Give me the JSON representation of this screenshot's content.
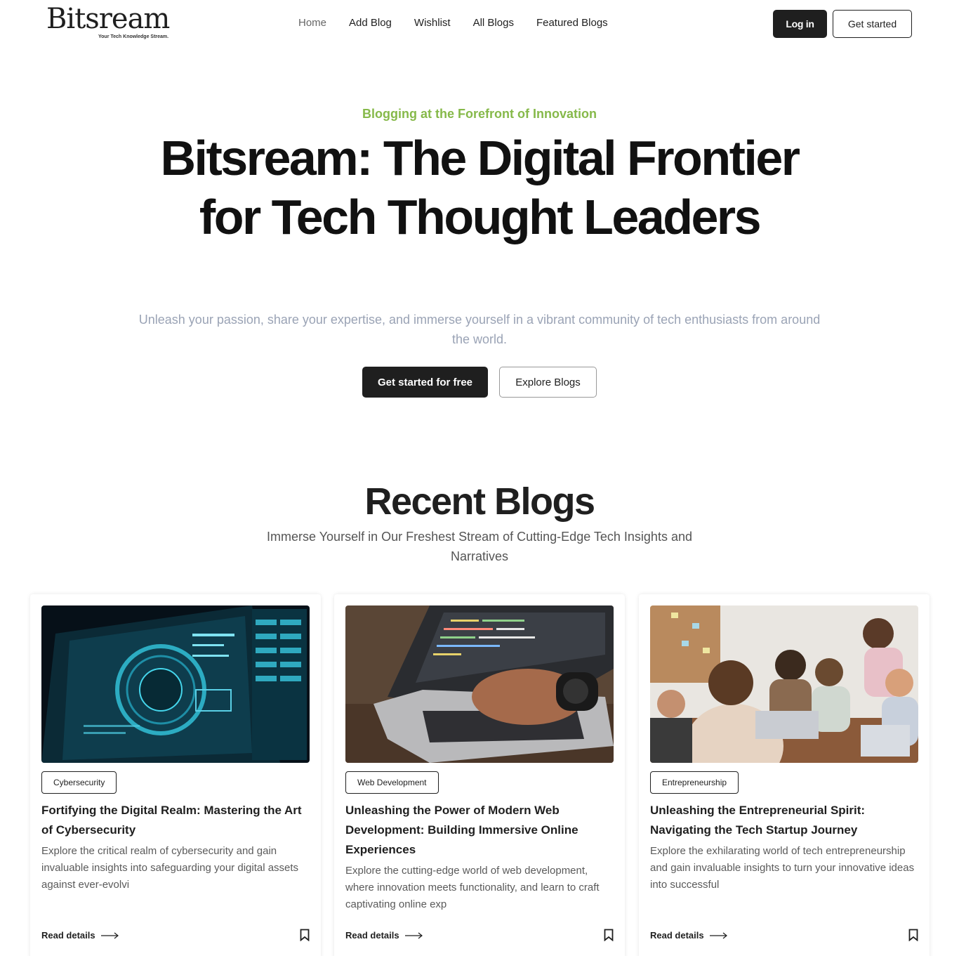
{
  "brand": {
    "name": "Bitsream",
    "tagline": "Your Tech Knowledge Stream."
  },
  "nav": {
    "items": [
      {
        "label": "Home"
      },
      {
        "label": "Add Blog"
      },
      {
        "label": "Wishlist"
      },
      {
        "label": "All Blogs"
      },
      {
        "label": "Featured Blogs"
      }
    ],
    "login_label": "Log in",
    "get_started_label": "Get started"
  },
  "hero": {
    "eyebrow": "Blogging at the Forefront of Innovation",
    "title": "Bitsream: The Digital Frontier for Tech Thought Leaders",
    "subtitle": "Unleash your passion, share your expertise, and immerse yourself in a vibrant community of tech enthusiasts from around the world.",
    "primary_cta": "Get started for free",
    "secondary_cta": "Explore Blogs"
  },
  "recent": {
    "title": "Recent Blogs",
    "subtitle": "Immerse Yourself in Our Freshest Stream of Cutting-Edge Tech Insights and Narratives",
    "read_label": "Read details",
    "cards": [
      {
        "category": "Cybersecurity",
        "title": "Fortifying the Digital Realm: Mastering the Art of Cybersecurity",
        "description": "Explore the critical realm of cybersecurity and gain invaluable insights into safeguarding your digital assets against ever-evolvi"
      },
      {
        "category": "Web Development",
        "title": "Unleashing the Power of Modern Web Development: Building Immersive Online Experiences",
        "description": "Explore the cutting-edge world of web development, where innovation meets functionality, and learn to craft captivating online exp"
      },
      {
        "category": "Entrepreneurship",
        "title": "Unleashing the Entrepreneurial Spirit: Navigating the Tech Startup Journey",
        "description": "Explore the exhilarating world of tech entrepreneurship and gain invaluable insights to turn your innovative ideas into successful"
      }
    ]
  },
  "colors": {
    "accent_green": "#86b94a",
    "dark": "#1f1f1f",
    "muted_text": "#9aa3b5"
  }
}
